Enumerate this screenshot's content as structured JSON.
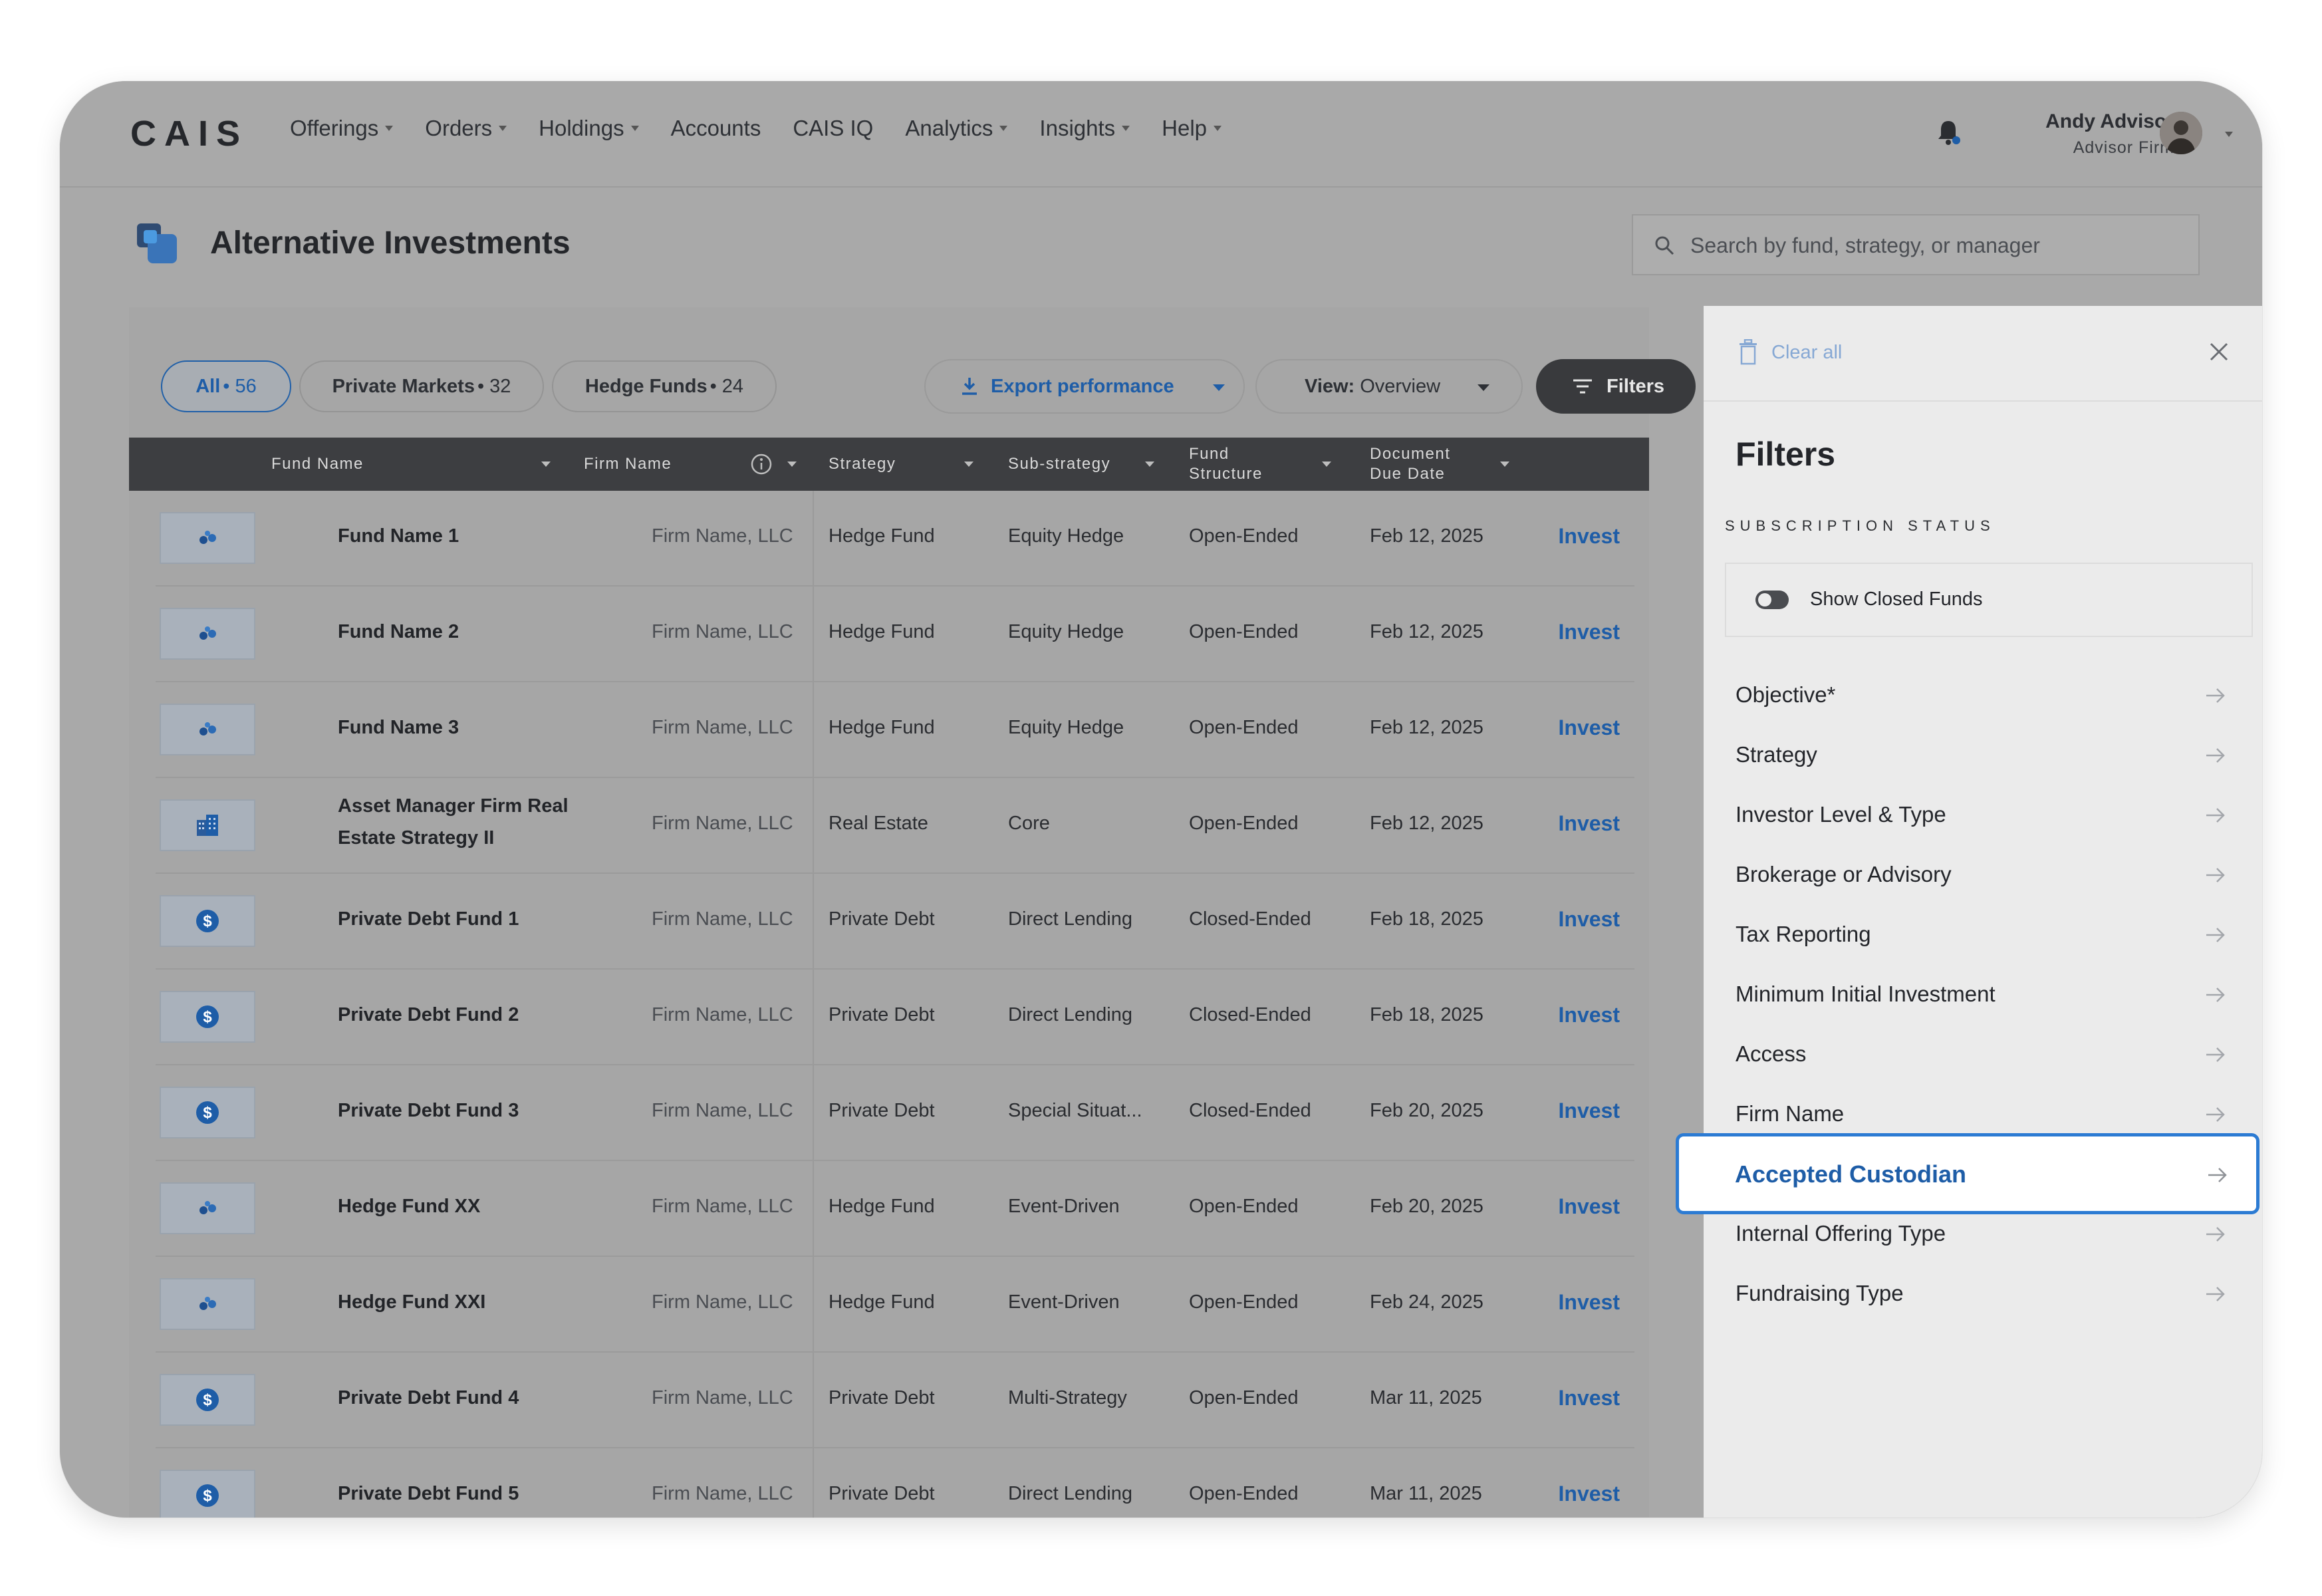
{
  "brand": "CAIS",
  "nav": {
    "items": [
      {
        "label": "Offerings",
        "dropdown": true
      },
      {
        "label": "Orders",
        "dropdown": true
      },
      {
        "label": "Holdings",
        "dropdown": true
      },
      {
        "label": "Accounts",
        "dropdown": false
      },
      {
        "label": "CAIS IQ",
        "dropdown": false
      },
      {
        "label": "Analytics",
        "dropdown": true
      },
      {
        "label": "Insights",
        "dropdown": true
      },
      {
        "label": "Help",
        "dropdown": true
      }
    ],
    "user": {
      "name": "Andy Advisor",
      "firm": "Advisor Firm"
    }
  },
  "header": {
    "title": "Alternative Investments",
    "search_placeholder": "Search by fund, strategy, or manager"
  },
  "toolbar": {
    "pill_all": {
      "label": "All",
      "count": "• 56"
    },
    "pill_pm": {
      "label": "Private Markets",
      "count": "• 32"
    },
    "pill_hf": {
      "label": "Hedge Funds",
      "count": "• 24"
    },
    "export_label": "Export performance",
    "view_prefix": "View:",
    "view_value": "Overview",
    "filters_label": "Filters"
  },
  "table": {
    "columns": {
      "fund_name": "Fund Name",
      "firm_name": "Firm Name",
      "strategy": "Strategy",
      "sub_strategy": "Sub-strategy",
      "fund_structure_1": "Fund",
      "fund_structure_2": "Structure",
      "doc_due_1": "Document",
      "doc_due_2": "Due Date"
    },
    "action_label": "Invest",
    "rows": [
      {
        "fund": "Fund Name 1",
        "firm": "Firm Name, LLC",
        "strategy": "Hedge Fund",
        "sub": "Equity Hedge",
        "structure": "Open-Ended",
        "due": "Feb 12, 2025",
        "icon": "dots-icon"
      },
      {
        "fund": "Fund Name 2",
        "firm": "Firm Name, LLC",
        "strategy": "Hedge Fund",
        "sub": "Equity Hedge",
        "structure": "Open-Ended",
        "due": "Feb 12, 2025",
        "icon": "dots-icon"
      },
      {
        "fund": "Fund Name 3",
        "firm": "Firm Name, LLC",
        "strategy": "Hedge Fund",
        "sub": "Equity Hedge",
        "structure": "Open-Ended",
        "due": "Feb 12, 2025",
        "icon": "dots-icon"
      },
      {
        "fund": "Asset Manager Firm Real",
        "fund2": "Estate Strategy II",
        "firm": "Firm Name, LLC",
        "strategy": "Real Estate",
        "sub": "Core",
        "structure": "Open-Ended",
        "due": "Feb 12, 2025",
        "icon": "building-icon"
      },
      {
        "fund": "Private Debt Fund 1",
        "firm": "Firm Name, LLC",
        "strategy": "Private Debt",
        "sub": "Direct Lending",
        "structure": "Closed-Ended",
        "due": "Feb 18, 2025",
        "icon": "dollar-icon"
      },
      {
        "fund": "Private Debt Fund 2",
        "firm": "Firm Name, LLC",
        "strategy": "Private Debt",
        "sub": "Direct Lending",
        "structure": "Closed-Ended",
        "due": "Feb 18, 2025",
        "icon": "dollar-icon"
      },
      {
        "fund": "Private Debt Fund 3",
        "firm": "Firm Name, LLC",
        "strategy": "Private Debt",
        "sub": "Special Situat...",
        "structure": "Closed-Ended",
        "due": "Feb 20, 2025",
        "icon": "dollar-icon"
      },
      {
        "fund": "Hedge Fund XX",
        "firm": "Firm Name, LLC",
        "strategy": "Hedge Fund",
        "sub": "Event-Driven",
        "structure": "Open-Ended",
        "due": "Feb 20, 2025",
        "icon": "dots-icon"
      },
      {
        "fund": "Hedge Fund XXI",
        "firm": "Firm Name, LLC",
        "strategy": "Hedge Fund",
        "sub": "Event-Driven",
        "structure": "Open-Ended",
        "due": "Feb 24, 2025",
        "icon": "dots-icon"
      },
      {
        "fund": "Private Debt Fund 4",
        "firm": "Firm Name, LLC",
        "strategy": "Private Debt",
        "sub": "Multi-Strategy",
        "structure": "Open-Ended",
        "due": "Mar 11, 2025",
        "icon": "dollar-icon"
      },
      {
        "fund": "Private Debt Fund 5",
        "firm": "Firm Name, LLC",
        "strategy": "Private Debt",
        "sub": "Direct Lending",
        "structure": "Open-Ended",
        "due": "Mar 11, 2025",
        "icon": "dollar-icon"
      }
    ]
  },
  "filters_panel": {
    "clear_all": "Clear all",
    "title": "Filters",
    "subscription_status": "SUBSCRIPTION STATUS",
    "show_closed": "Show Closed Funds",
    "show_closed_on": false,
    "items": [
      "Objective*",
      "Strategy",
      "Investor Level & Type",
      "Brokerage or Advisory",
      "Tax Reporting",
      "Minimum Initial Investment",
      "Access",
      "Firm Name",
      "Accepted Custodian",
      "Internal Offering Type",
      "Fundraising Type"
    ],
    "active_item": "Accepted Custodian"
  },
  "colors": {
    "accent": "#1e5da7",
    "highlight_border": "#2c7bd3",
    "overlay": "#a9a9a9",
    "panel_bg": "#ebebeb"
  }
}
